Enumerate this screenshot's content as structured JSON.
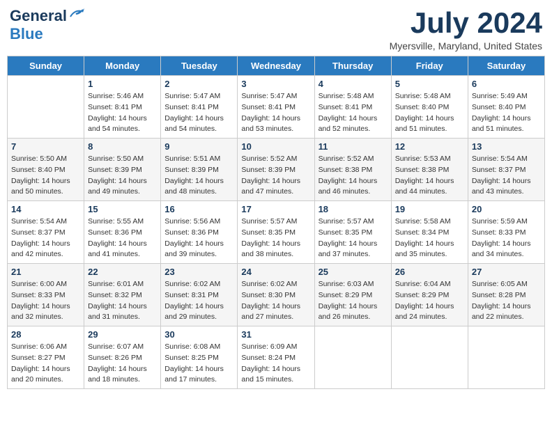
{
  "logo": {
    "general": "General",
    "blue": "Blue"
  },
  "title": {
    "month_year": "July 2024",
    "location": "Myersville, Maryland, United States"
  },
  "days_of_week": [
    "Sunday",
    "Monday",
    "Tuesday",
    "Wednesday",
    "Thursday",
    "Friday",
    "Saturday"
  ],
  "weeks": [
    [
      {
        "day": "",
        "info": ""
      },
      {
        "day": "1",
        "info": "Sunrise: 5:46 AM\nSunset: 8:41 PM\nDaylight: 14 hours\nand 54 minutes."
      },
      {
        "day": "2",
        "info": "Sunrise: 5:47 AM\nSunset: 8:41 PM\nDaylight: 14 hours\nand 54 minutes."
      },
      {
        "day": "3",
        "info": "Sunrise: 5:47 AM\nSunset: 8:41 PM\nDaylight: 14 hours\nand 53 minutes."
      },
      {
        "day": "4",
        "info": "Sunrise: 5:48 AM\nSunset: 8:41 PM\nDaylight: 14 hours\nand 52 minutes."
      },
      {
        "day": "5",
        "info": "Sunrise: 5:48 AM\nSunset: 8:40 PM\nDaylight: 14 hours\nand 51 minutes."
      },
      {
        "day": "6",
        "info": "Sunrise: 5:49 AM\nSunset: 8:40 PM\nDaylight: 14 hours\nand 51 minutes."
      }
    ],
    [
      {
        "day": "7",
        "info": "Sunrise: 5:50 AM\nSunset: 8:40 PM\nDaylight: 14 hours\nand 50 minutes."
      },
      {
        "day": "8",
        "info": "Sunrise: 5:50 AM\nSunset: 8:39 PM\nDaylight: 14 hours\nand 49 minutes."
      },
      {
        "day": "9",
        "info": "Sunrise: 5:51 AM\nSunset: 8:39 PM\nDaylight: 14 hours\nand 48 minutes."
      },
      {
        "day": "10",
        "info": "Sunrise: 5:52 AM\nSunset: 8:39 PM\nDaylight: 14 hours\nand 47 minutes."
      },
      {
        "day": "11",
        "info": "Sunrise: 5:52 AM\nSunset: 8:38 PM\nDaylight: 14 hours\nand 46 minutes."
      },
      {
        "day": "12",
        "info": "Sunrise: 5:53 AM\nSunset: 8:38 PM\nDaylight: 14 hours\nand 44 minutes."
      },
      {
        "day": "13",
        "info": "Sunrise: 5:54 AM\nSunset: 8:37 PM\nDaylight: 14 hours\nand 43 minutes."
      }
    ],
    [
      {
        "day": "14",
        "info": "Sunrise: 5:54 AM\nSunset: 8:37 PM\nDaylight: 14 hours\nand 42 minutes."
      },
      {
        "day": "15",
        "info": "Sunrise: 5:55 AM\nSunset: 8:36 PM\nDaylight: 14 hours\nand 41 minutes."
      },
      {
        "day": "16",
        "info": "Sunrise: 5:56 AM\nSunset: 8:36 PM\nDaylight: 14 hours\nand 39 minutes."
      },
      {
        "day": "17",
        "info": "Sunrise: 5:57 AM\nSunset: 8:35 PM\nDaylight: 14 hours\nand 38 minutes."
      },
      {
        "day": "18",
        "info": "Sunrise: 5:57 AM\nSunset: 8:35 PM\nDaylight: 14 hours\nand 37 minutes."
      },
      {
        "day": "19",
        "info": "Sunrise: 5:58 AM\nSunset: 8:34 PM\nDaylight: 14 hours\nand 35 minutes."
      },
      {
        "day": "20",
        "info": "Sunrise: 5:59 AM\nSunset: 8:33 PM\nDaylight: 14 hours\nand 34 minutes."
      }
    ],
    [
      {
        "day": "21",
        "info": "Sunrise: 6:00 AM\nSunset: 8:33 PM\nDaylight: 14 hours\nand 32 minutes."
      },
      {
        "day": "22",
        "info": "Sunrise: 6:01 AM\nSunset: 8:32 PM\nDaylight: 14 hours\nand 31 minutes."
      },
      {
        "day": "23",
        "info": "Sunrise: 6:02 AM\nSunset: 8:31 PM\nDaylight: 14 hours\nand 29 minutes."
      },
      {
        "day": "24",
        "info": "Sunrise: 6:02 AM\nSunset: 8:30 PM\nDaylight: 14 hours\nand 27 minutes."
      },
      {
        "day": "25",
        "info": "Sunrise: 6:03 AM\nSunset: 8:29 PM\nDaylight: 14 hours\nand 26 minutes."
      },
      {
        "day": "26",
        "info": "Sunrise: 6:04 AM\nSunset: 8:29 PM\nDaylight: 14 hours\nand 24 minutes."
      },
      {
        "day": "27",
        "info": "Sunrise: 6:05 AM\nSunset: 8:28 PM\nDaylight: 14 hours\nand 22 minutes."
      }
    ],
    [
      {
        "day": "28",
        "info": "Sunrise: 6:06 AM\nSunset: 8:27 PM\nDaylight: 14 hours\nand 20 minutes."
      },
      {
        "day": "29",
        "info": "Sunrise: 6:07 AM\nSunset: 8:26 PM\nDaylight: 14 hours\nand 18 minutes."
      },
      {
        "day": "30",
        "info": "Sunrise: 6:08 AM\nSunset: 8:25 PM\nDaylight: 14 hours\nand 17 minutes."
      },
      {
        "day": "31",
        "info": "Sunrise: 6:09 AM\nSunset: 8:24 PM\nDaylight: 14 hours\nand 15 minutes."
      },
      {
        "day": "",
        "info": ""
      },
      {
        "day": "",
        "info": ""
      },
      {
        "day": "",
        "info": ""
      }
    ]
  ]
}
